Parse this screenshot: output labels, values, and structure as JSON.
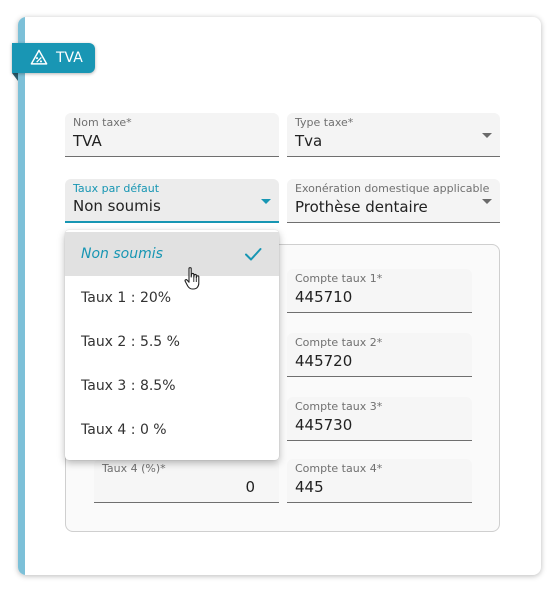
{
  "section": {
    "badge_label": "TVA",
    "badge_icon": "tax-percent-icon",
    "accent_color": "#1996b4"
  },
  "fields": {
    "nom_taxe": {
      "label": "Nom taxe*",
      "value": "TVA"
    },
    "type_taxe": {
      "label": "Type taxe*",
      "value": "Tva"
    },
    "taux_defaut": {
      "label": "Taux par défaut",
      "value": "Non soumis"
    },
    "exoneration": {
      "label": "Exonération domestique applicable",
      "value": "Prothèse dentaire"
    }
  },
  "dropdown": {
    "options": [
      "Non soumis",
      "Taux 1 : 20%",
      "Taux 2 : 5.5 %",
      "Taux 3 : 8.5%",
      "Taux 4 : 0 %"
    ],
    "selected": "Non soumis"
  },
  "rates": {
    "taux4": {
      "label": "Taux 4 (%)*",
      "value": "0"
    }
  },
  "comptes": [
    {
      "label": "Compte taux 1*",
      "value": "445710"
    },
    {
      "label": "Compte taux 2*",
      "value": "445720"
    },
    {
      "label": "Compte taux 3*",
      "value": "445730"
    },
    {
      "label": "Compte taux 4*",
      "value": "445"
    }
  ]
}
